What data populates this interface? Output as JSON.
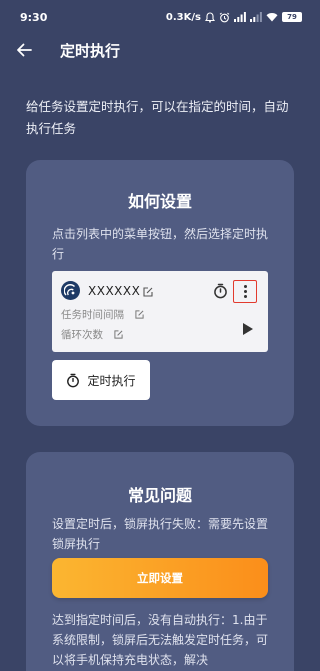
{
  "status_bar": {
    "time": "9:30",
    "network_speed": "0.3K/s",
    "battery": "79"
  },
  "app_bar": {
    "title": "定时执行"
  },
  "intro": {
    "text": "给任务设置定时执行，可以在指定的时间，自动执行任务"
  },
  "setup_card": {
    "title": "如何设置",
    "description": "点击列表中的菜单按钮，然后选择定时执行",
    "demo_item": {
      "name": "XXXXXX",
      "interval_label": "任务时间间隔",
      "loop_label": "循环次数"
    },
    "timer_button_label": "定时执行"
  },
  "faq_card": {
    "title": "常见问题",
    "q1": "设置定时后，锁屏执行失败：需要先设置 锁屏执行",
    "action_button_label": "立即设置",
    "q2": "达到指定时间后，没有自动执行：1.由于系统限制，锁屏后无法触发定时任务，可以将手机保持充电状态，解决"
  },
  "colors": {
    "background": "#3a4466",
    "card": "#515c82",
    "accent_gradient_start": "#fbb631",
    "accent_gradient_end": "#fb8e1a",
    "highlight_border": "#e23a2e"
  },
  "icons": {
    "back": "arrow-left-icon",
    "timer": "stopwatch-icon",
    "edit": "edit-icon",
    "more": "more-vertical-icon",
    "play": "play-icon"
  }
}
